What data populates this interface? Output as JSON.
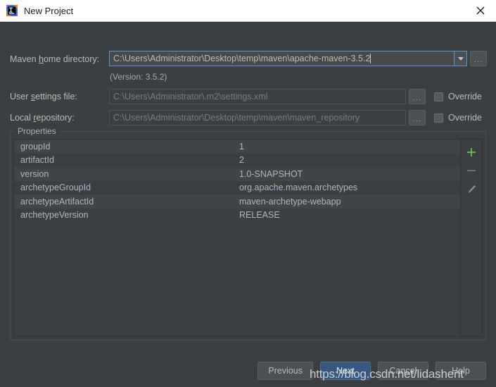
{
  "window": {
    "title": "New Project",
    "app_icon": "intellij-idea-icon",
    "close_icon": "close-icon",
    "titlebar_bg": "#ffffff",
    "body_bg": "#3c3f41"
  },
  "form": {
    "maven_home": {
      "label_prefix": "Maven ",
      "label_mnemonic": "h",
      "label_suffix": "ome directory:",
      "value": "C:\\Users\\Administrator\\Desktop\\temp\\maven\\apache-maven-3.5.2",
      "placeholder": "",
      "dropdown_icon": "chevron-down-icon",
      "browse_label": "...",
      "focus_color": "#5a93d4"
    },
    "version_note": "(Version: 3.5.2)",
    "user_settings": {
      "label_prefix": "User ",
      "label_mnemonic": "s",
      "label_suffix": "ettings file:",
      "value": "C:\\Users\\Administrator\\.m2\\settings.xml",
      "placeholder": "",
      "browse_label": "...",
      "override_label": "Override",
      "override_checked": false
    },
    "local_repository": {
      "label_prefix": "Local ",
      "label_mnemonic": "r",
      "label_suffix": "epository:",
      "value": "C:\\Users\\Administrator\\Desktop\\temp\\maven\\maven_repository",
      "placeholder": "",
      "browse_label": "...",
      "override_label": "Override",
      "override_checked": false
    }
  },
  "properties": {
    "legend": "Properties",
    "rows": [
      {
        "key": "groupId",
        "value": "1"
      },
      {
        "key": "artifactId",
        "value": "2"
      },
      {
        "key": "version",
        "value": "1.0-SNAPSHOT"
      },
      {
        "key": "archetypeGroupId",
        "value": "org.apache.maven.archetypes"
      },
      {
        "key": "archetypeArtifactId",
        "value": "maven-archetype-webapp"
      },
      {
        "key": "archetypeVersion",
        "value": "RELEASE"
      }
    ],
    "toolbar": {
      "add_icon": "plus-icon",
      "add_color": "#62b543",
      "remove_icon": "minus-icon",
      "remove_color": "#6e7173",
      "edit_icon": "pencil-icon",
      "edit_color": "#8d8f90"
    }
  },
  "buttons": {
    "previous": "Previous",
    "next": "Next",
    "cancel": "Cancel",
    "help": "Help",
    "primary_color": "#365880"
  },
  "watermark": {
    "text": "https://blog.csdn.net/lidashent"
  }
}
